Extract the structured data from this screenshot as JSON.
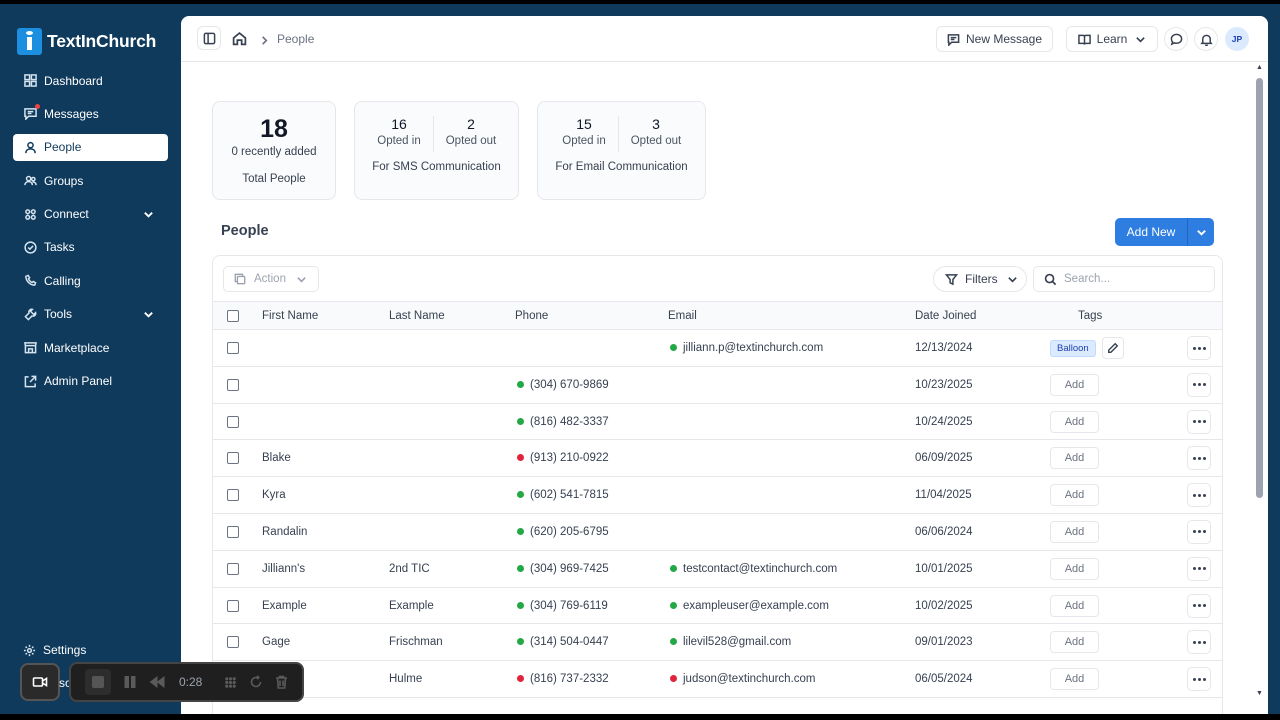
{
  "app": {
    "logo_text": "TextInChurch",
    "brand_color": "#0f3a5c",
    "accent_color": "#2d7ee0"
  },
  "sidebar": {
    "items": [
      {
        "label": "Dashboard",
        "icon": "dashboard-icon"
      },
      {
        "label": "Messages",
        "icon": "messages-icon",
        "notification": true
      },
      {
        "label": "People",
        "icon": "person-icon",
        "active": true
      },
      {
        "label": "Groups",
        "icon": "groups-icon"
      },
      {
        "label": "Connect",
        "icon": "connect-icon",
        "expandable": true
      },
      {
        "label": "Tasks",
        "icon": "tasks-icon"
      },
      {
        "label": "Calling",
        "icon": "phone-icon"
      },
      {
        "label": "Tools",
        "icon": "tools-icon",
        "expandable": true
      },
      {
        "label": "Marketplace",
        "icon": "marketplace-icon"
      },
      {
        "label": "Admin Panel",
        "icon": "admin-icon"
      }
    ],
    "settings_label": "Settings"
  },
  "topbar": {
    "breadcrumb": "People",
    "new_message_label": "New Message",
    "learn_label": "Learn",
    "avatar_initials": "JP"
  },
  "stats": {
    "total": {
      "value": "18",
      "recent": "0 recently added",
      "label": "Total People"
    },
    "sms": {
      "in_value": "16",
      "in_label": "Opted in",
      "out_value": "2",
      "out_label": "Opted out",
      "label": "For SMS Communication"
    },
    "email": {
      "in_value": "15",
      "in_label": "Opted in",
      "out_value": "3",
      "out_label": "Opted out",
      "label": "For Email Communication"
    }
  },
  "people": {
    "title": "People",
    "add_new_label": "Add New",
    "action_label": "Action",
    "filters_label": "Filters",
    "search_placeholder": "Search...",
    "columns": [
      "First Name",
      "Last Name",
      "Phone",
      "Email",
      "Date Joined",
      "Tags"
    ],
    "rows": [
      {
        "first": "",
        "last": "",
        "phone": "",
        "phone_status": "",
        "email": "jilliann.p@textinchurch.com",
        "email_status": "green",
        "date": "12/13/2024",
        "tag": "Balloon"
      },
      {
        "first": "",
        "last": "",
        "phone": "(304) 670-9869",
        "phone_status": "green",
        "email": "",
        "email_status": "",
        "date": "10/23/2025",
        "tag": ""
      },
      {
        "first": "",
        "last": "",
        "phone": "(816) 482-3337",
        "phone_status": "green",
        "email": "",
        "email_status": "",
        "date": "10/24/2025",
        "tag": ""
      },
      {
        "first": "Blake",
        "last": "",
        "phone": "(913) 210-0922",
        "phone_status": "red",
        "email": "",
        "email_status": "",
        "date": "06/09/2025",
        "tag": ""
      },
      {
        "first": "Kyra",
        "last": "",
        "phone": "(602) 541-7815",
        "phone_status": "green",
        "email": "",
        "email_status": "",
        "date": "11/04/2025",
        "tag": ""
      },
      {
        "first": "Randalin",
        "last": "",
        "phone": "(620) 205-6795",
        "phone_status": "green",
        "email": "",
        "email_status": "",
        "date": "06/06/2024",
        "tag": ""
      },
      {
        "first": "Jilliann's",
        "last": "2nd TIC",
        "phone": "(304) 969-7425",
        "phone_status": "green",
        "email": "testcontact@textinchurch.com",
        "email_status": "green",
        "date": "10/01/2025",
        "tag": ""
      },
      {
        "first": "Example",
        "last": "Example",
        "phone": "(304) 769-6119",
        "phone_status": "green",
        "email": "exampleuser@example.com",
        "email_status": "green",
        "date": "10/02/2025",
        "tag": ""
      },
      {
        "first": "Gage",
        "last": "Frischman",
        "phone": "(314) 504-0447",
        "phone_status": "green",
        "email": "lilevil528@gmail.com",
        "email_status": "green",
        "date": "09/01/2023",
        "tag": ""
      },
      {
        "first": "",
        "last": "Hulme",
        "phone": "(816) 737-2332",
        "phone_status": "red",
        "email": "judson@textinchurch.com",
        "email_status": "red",
        "date": "06/05/2024",
        "tag": ""
      }
    ],
    "add_tag_label": "Add",
    "status_colors": {
      "green": "#22a845",
      "red": "#e0243c"
    }
  },
  "recorder": {
    "time": "0:28",
    "partial_text": "so"
  }
}
